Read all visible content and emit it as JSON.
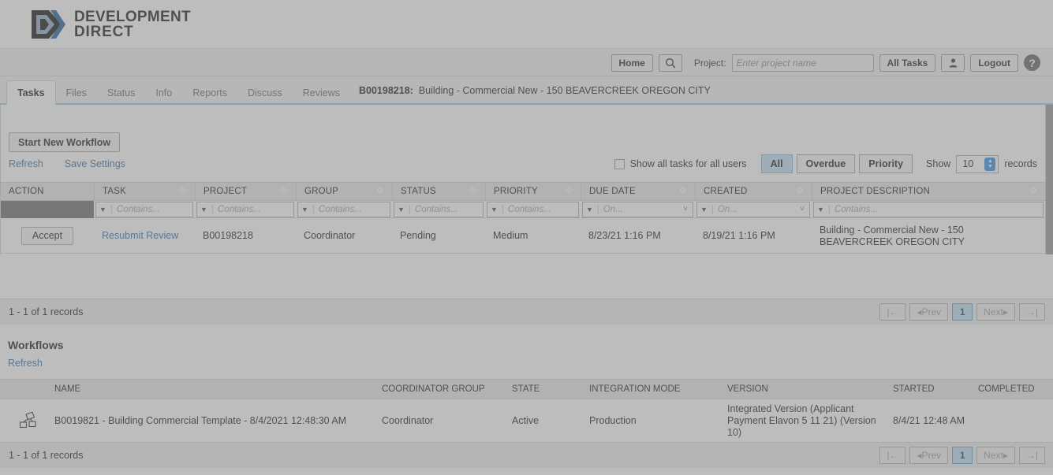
{
  "brand": {
    "logo_line1": "Development",
    "logo_line2": "Direct",
    "logo_icon": "dd-chevron-logo",
    "accent_blue": "#2f6fa8",
    "tab_underline": "#8ecdea",
    "selected_fill": "#bfe0f3"
  },
  "navbar": {
    "home_label": "Home",
    "search_icon": "search-icon",
    "project_label": "Project:",
    "project_placeholder": "Enter project name",
    "project_value": "",
    "all_tasks_label": "All Tasks",
    "user_icon": "user-icon",
    "logout_label": "Logout",
    "help_icon": "help-icon"
  },
  "tabs": [
    {
      "label": "Tasks",
      "active": true
    },
    {
      "label": "Files",
      "active": false
    },
    {
      "label": "Status",
      "active": false
    },
    {
      "label": "Info",
      "active": false
    },
    {
      "label": "Reports",
      "active": false
    },
    {
      "label": "Discuss",
      "active": false
    },
    {
      "label": "Reviews",
      "active": false
    }
  ],
  "project_banner": {
    "id": "B00198218:",
    "description": "Building - Commercial New - 150 BEAVERCREEK OREGON CITY"
  },
  "toolbar": {
    "start_workflow_label": "Start New Workflow",
    "refresh_label": "Refresh",
    "save_settings_label": "Save Settings",
    "show_all_tasks_label": "Show all tasks for all users",
    "show_all_tasks_checked": false,
    "filter_all": "All",
    "filter_overdue": "Overdue",
    "filter_priority": "Priority",
    "active_filter": "All",
    "show_label": "Show",
    "records_value": "10",
    "records_suffix": "records"
  },
  "tasks_table": {
    "columns": [
      {
        "label": "ACTION",
        "gear": false
      },
      {
        "label": "TASK",
        "gear": true
      },
      {
        "label": "PROJECT",
        "gear": true
      },
      {
        "label": "GROUP",
        "gear": true
      },
      {
        "label": "STATUS",
        "gear": true
      },
      {
        "label": "PRIORITY",
        "gear": true
      },
      {
        "label": "DUE DATE",
        "gear": true
      },
      {
        "label": "CREATED",
        "gear": true
      },
      {
        "label": "PROJECT DESCRIPTION",
        "gear": true
      }
    ],
    "filters": [
      {
        "type": "blocked",
        "placeholder": ""
      },
      {
        "type": "text",
        "placeholder": "Contains..."
      },
      {
        "type": "text",
        "placeholder": "Contains..."
      },
      {
        "type": "text",
        "placeholder": "Contains..."
      },
      {
        "type": "text",
        "placeholder": "Contains..."
      },
      {
        "type": "text",
        "placeholder": "Contains..."
      },
      {
        "type": "date",
        "placeholder": "On..."
      },
      {
        "type": "date",
        "placeholder": "On..."
      },
      {
        "type": "text",
        "placeholder": "Contains..."
      }
    ],
    "rows": [
      {
        "action_label": "Accept",
        "task": "Resubmit Review",
        "project": "B00198218",
        "group": "Coordinator",
        "status": "Pending",
        "priority": "Medium",
        "due_date": "8/23/21 1:16 PM",
        "created": "8/19/21 1:16 PM",
        "description": "Building - Commercial New - 150 BEAVERCREEK OREGON CITY"
      }
    ],
    "record_count": "1 - 1 of 1 records",
    "pager": {
      "first": "|←",
      "prev": "◂Prev",
      "page": "1",
      "next": "Next▸",
      "last": "→|"
    }
  },
  "workflows": {
    "title": "Workflows",
    "refresh_label": "Refresh",
    "columns": [
      "NAME",
      "COORDINATOR GROUP",
      "STATE",
      "INTEGRATION MODE",
      "VERSION",
      "STARTED",
      "COMPLETED"
    ],
    "rows": [
      {
        "icon": "workflow-diagram-icon",
        "name": "B0019821 - Building Commercial Template - 8/4/2021 12:48:30 AM",
        "coordinator_group": "Coordinator",
        "state": "Active",
        "integration_mode": "Production",
        "version": "Integrated Version (Applicant Payment Elavon 5 11 21) (Version 10)",
        "started": "8/4/21 12:48 AM",
        "completed": ""
      }
    ],
    "record_count": "1 - 1 of 1 records",
    "pager": {
      "first": "|←",
      "prev": "◂Prev",
      "page": "1",
      "next": "Next▸",
      "last": "→|"
    }
  }
}
